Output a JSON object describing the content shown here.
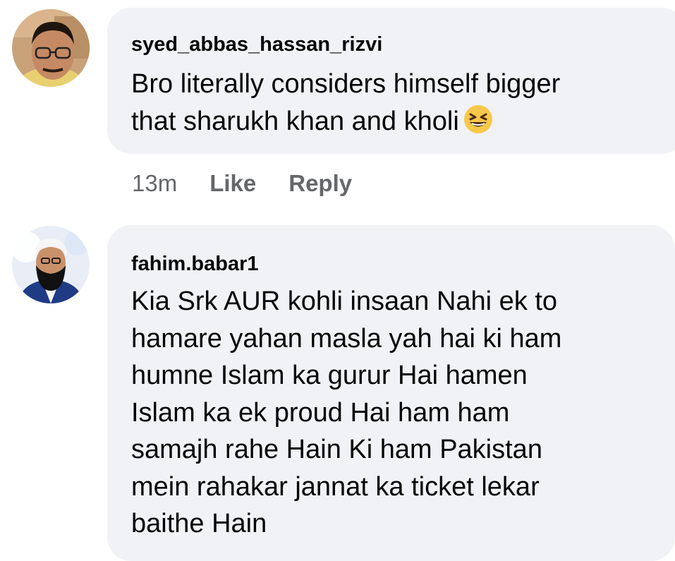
{
  "comments": [
    {
      "author": "syed_abbas_hassan_rizvi",
      "text": "Bro literally considers himself bigger\nthat sharukh khan and kholi",
      "emoji": "grinning-squinting-face-icon",
      "time": "13m",
      "like_label": "Like",
      "reply_label": "Reply"
    },
    {
      "author": "fahim.babar1",
      "text": "Kia Srk AUR kohli insaan Nahi  ek to\nhamare yahan masla yah hai ki ham\nhumne Islam ka gurur Hai hamen\nIslam ka ek proud Hai ham ham\nsamajh rahe Hain Ki ham Pakistan\nmein rahakar jannat ka ticket lekar\nbaithe Hain"
    }
  ],
  "colors": {
    "bubble": "#f0f2f5",
    "text": "#050505",
    "meta": "#65676b"
  }
}
